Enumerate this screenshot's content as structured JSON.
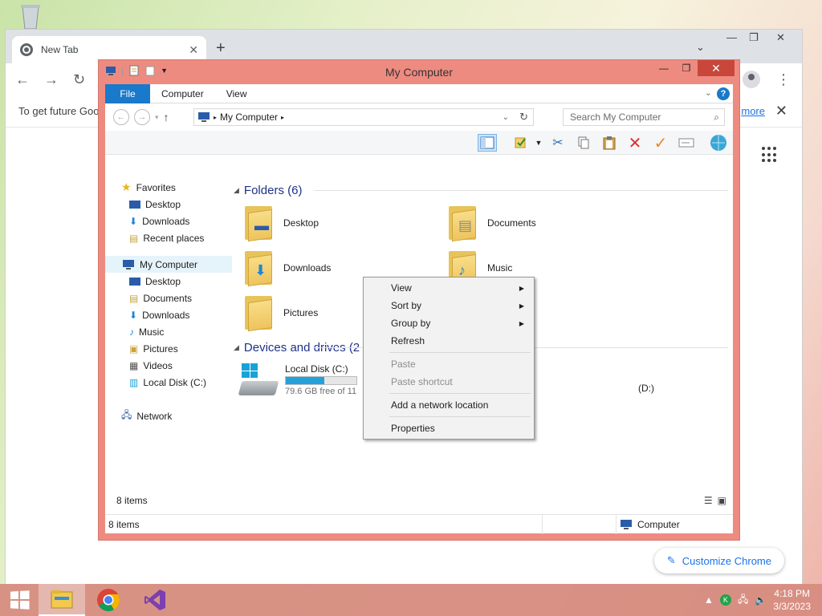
{
  "chrome": {
    "tab_title": "New Tab",
    "infobar_text": "To get future Goo",
    "infobar_link": "more",
    "customize_label": "Customize Chrome"
  },
  "explorer": {
    "title": "My Computer",
    "ribbon_tabs": [
      "File",
      "Computer",
      "View"
    ],
    "address": "My Computer",
    "search_placeholder": "Search My Computer",
    "nav": {
      "favorites": "Favorites",
      "fav_items": [
        "Desktop",
        "Downloads",
        "Recent places"
      ],
      "computer": "My Computer",
      "comp_items": [
        "Desktop",
        "Documents",
        "Downloads",
        "Music",
        "Pictures",
        "Videos",
        "Local Disk (C:)"
      ],
      "network": "Network"
    },
    "folders_header": "Folders (6)",
    "folders": [
      "Desktop",
      "Documents",
      "Downloads",
      "Music",
      "Pictures"
    ],
    "devices_header": "Devices and drives (2",
    "drive": {
      "name": "Local Disk (C:)",
      "free": "79.6 GB free of 11",
      "fill": 0.55
    },
    "drive2_label": "(D:)",
    "items_count": "8 items",
    "status_count": "8 items",
    "status_location": "Computer"
  },
  "context_menu": {
    "view": "View",
    "sort_by": "Sort by",
    "group_by": "Group by",
    "refresh": "Refresh",
    "paste": "Paste",
    "paste_shortcut": "Paste shortcut",
    "add_network": "Add a network location",
    "properties": "Properties"
  },
  "taskbar": {
    "time": "4:18 PM",
    "date": "3/3/2023"
  },
  "colors": {
    "window_frame": "#ee8b80",
    "accent": "#1979ca",
    "taskbar": "#d68c80"
  }
}
